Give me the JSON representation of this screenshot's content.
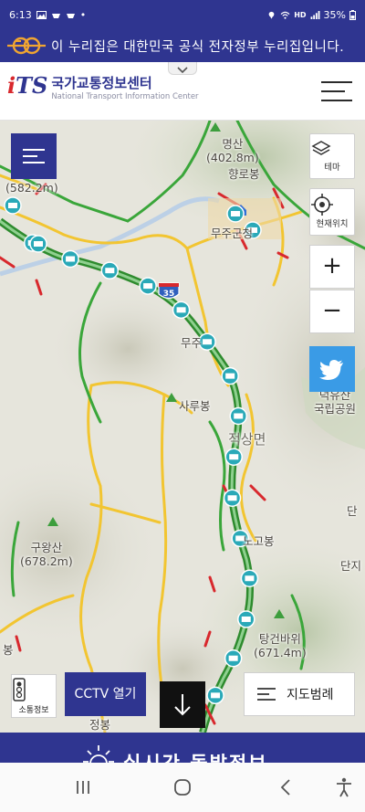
{
  "status_bar": {
    "time": "6:13",
    "network": "HD",
    "battery": "35%"
  },
  "gov_banner": {
    "text": "이 누리집은 대한민국 공식 전자정부 누리집입니다."
  },
  "header": {
    "logo_mark": "iTS",
    "logo_title": "국가교통정보센터",
    "logo_subtitle": "National Transport Information Center"
  },
  "map": {
    "places": [
      {
        "id": "myeongsan",
        "name": "명산",
        "elevation": "(402.8m)"
      },
      {
        "id": "peak582",
        "name": "",
        "elevation": "(582.2m)"
      },
      {
        "id": "hyangrobong",
        "name": "향로봉"
      },
      {
        "id": "muju-county",
        "name": "무주군청"
      },
      {
        "id": "muju",
        "name": "무주"
      },
      {
        "id": "sarubong",
        "name": "사루봉"
      },
      {
        "id": "jeoksang",
        "name": "적상면"
      },
      {
        "id": "deogyusan",
        "name": "덕유산\n국립공원"
      },
      {
        "id": "nogobong",
        "name": "노고봉"
      },
      {
        "id": "guwangsan",
        "name": "구왕산",
        "elevation": "(678.2m)"
      },
      {
        "id": "tanggeonbawi",
        "name": "탕건바위",
        "elevation": "(671.4m)"
      },
      {
        "id": "danji",
        "name": "단지"
      },
      {
        "id": "dan",
        "name": "단"
      },
      {
        "id": "bong",
        "name": "봉"
      },
      {
        "id": "jeongbong",
        "name": "정봉"
      }
    ],
    "highway_shield": "35",
    "cctv_count": 19
  },
  "controls": {
    "theme_label": "테마",
    "location_label": "현재위치",
    "zoom_in": "+",
    "zoom_out": "−",
    "signal_label": "소통정보",
    "cctv_label": "CCTV 열기",
    "legend_label": "지도범례"
  },
  "bottom_banner": {
    "text": "실시간 돌발정보"
  },
  "colors": {
    "brand": "#2f3590",
    "accent_red": "#d8282d",
    "flow_green": "#3aa63a",
    "flow_yellow": "#f2c531",
    "flow_red": "#d8282d",
    "cctv": "#2aa9b8",
    "twitter": "#3a9be6"
  }
}
